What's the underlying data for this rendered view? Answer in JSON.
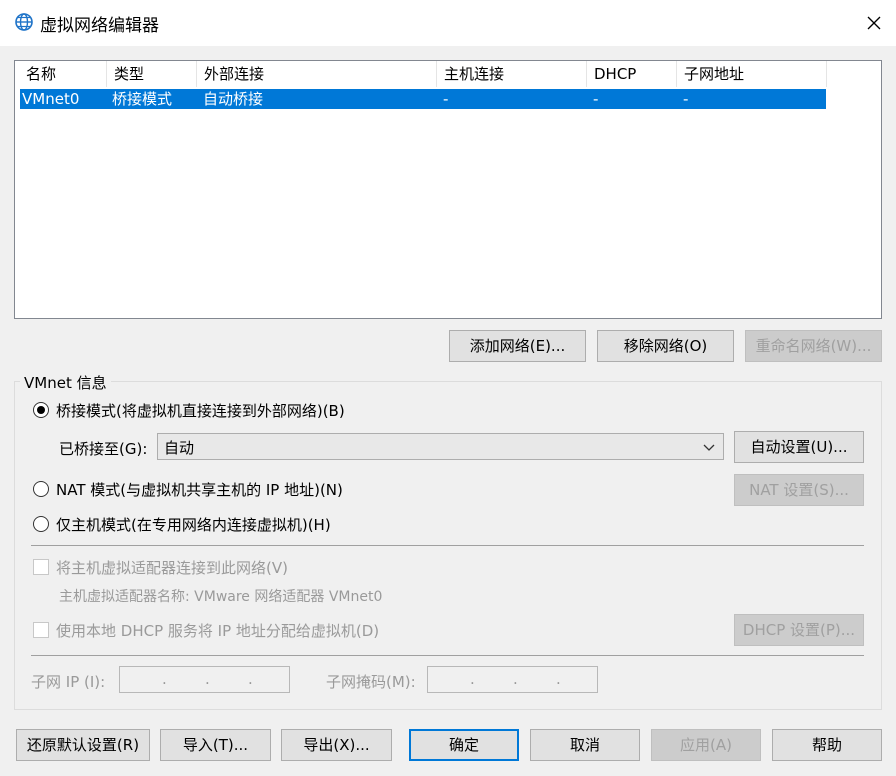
{
  "window": {
    "title": "虚拟网络编辑器",
    "icon": "network-globe-icon"
  },
  "table": {
    "columns": [
      "名称",
      "类型",
      "外部连接",
      "主机连接",
      "DHCP",
      "子网地址"
    ],
    "rows": [
      {
        "name": "VMnet0",
        "type": "桥接模式",
        "external": "自动桥接",
        "host": "-",
        "dhcp": "-",
        "subnet": "-"
      }
    ]
  },
  "network_buttons": {
    "add": "添加网络(E)...",
    "remove": "移除网络(O)",
    "rename": "重命名网络(W)..."
  },
  "vmnet_info": {
    "group_title": "VMnet 信息",
    "bridged_mode": "桥接模式(将虚拟机直接连接到外部网络)(B)",
    "bridged_to_label": "已桥接至(G):",
    "bridged_to_value": "自动",
    "auto_settings": "自动设置(U)...",
    "nat_mode": "NAT 模式(与虚拟机共享主机的 IP 地址)(N)",
    "nat_settings": "NAT 设置(S)...",
    "host_only_mode": "仅主机模式(在专用网络内连接虚拟机)(H)",
    "connect_adapter": "将主机虚拟适配器连接到此网络(V)",
    "adapter_name": "主机虚拟适配器名称: VMware 网络适配器 VMnet0",
    "use_dhcp": "使用本地 DHCP 服务将 IP 地址分配给虚拟机(D)",
    "dhcp_settings": "DHCP 设置(P)...",
    "subnet_ip_label": "子网 IP (I):",
    "subnet_mask_label": "子网掩码(M):",
    "ip_dot": "."
  },
  "footer": {
    "restore_defaults": "还原默认设置(R)",
    "import": "导入(T)...",
    "export": "导出(X)...",
    "ok": "确定",
    "cancel": "取消",
    "apply": "应用(A)",
    "help": "帮助"
  }
}
